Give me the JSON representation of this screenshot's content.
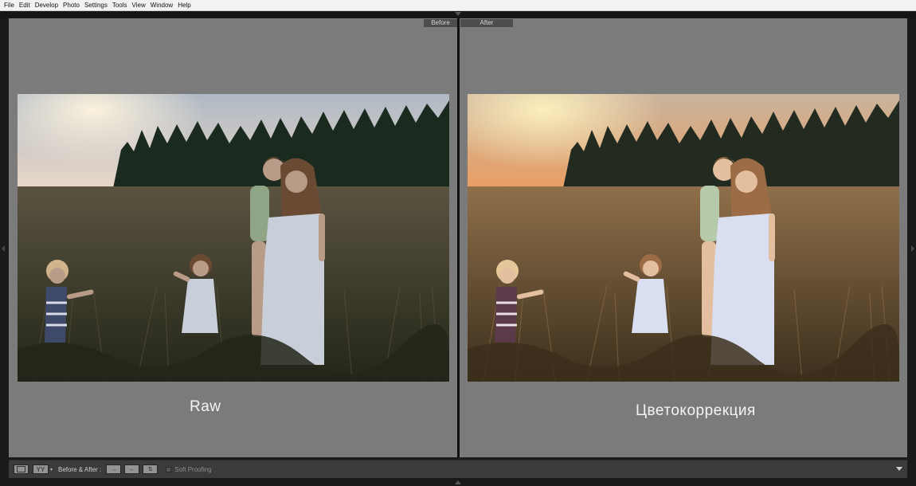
{
  "menu": [
    "File",
    "Edit",
    "Develop",
    "Photo",
    "Settings",
    "Tools",
    "View",
    "Window",
    "Help"
  ],
  "before": {
    "tag": "Before",
    "caption": "Raw",
    "photo_alt": "",
    "palette": {
      "sky_top": "#aeb8c4",
      "sky_bottom": "#ead8c8",
      "sun": "#fff4de",
      "trees": "#1b2a1f",
      "field_top": "#5a5340",
      "field_bottom": "#232619",
      "dress": "#c8cfd8",
      "skin": "#b99c87",
      "hair": "#6b4a34"
    }
  },
  "after": {
    "tag": "After",
    "caption": "Цветокоррекция",
    "photo_alt": "",
    "palette": {
      "sky_top": "#c9b39c",
      "sky_bottom": "#ea9f63",
      "sun": "#fff2c0",
      "trees": "#232a20",
      "field_top": "#8f6f4a",
      "field_bottom": "#3b2f1c",
      "dress": "#d9def0",
      "skin": "#e3bf9f",
      "hair": "#9b6c45"
    }
  },
  "toolbar": {
    "view_mode_label": "YY",
    "before_after_label": "Before & After :",
    "soft_proofing_label": "Soft Proofing"
  }
}
